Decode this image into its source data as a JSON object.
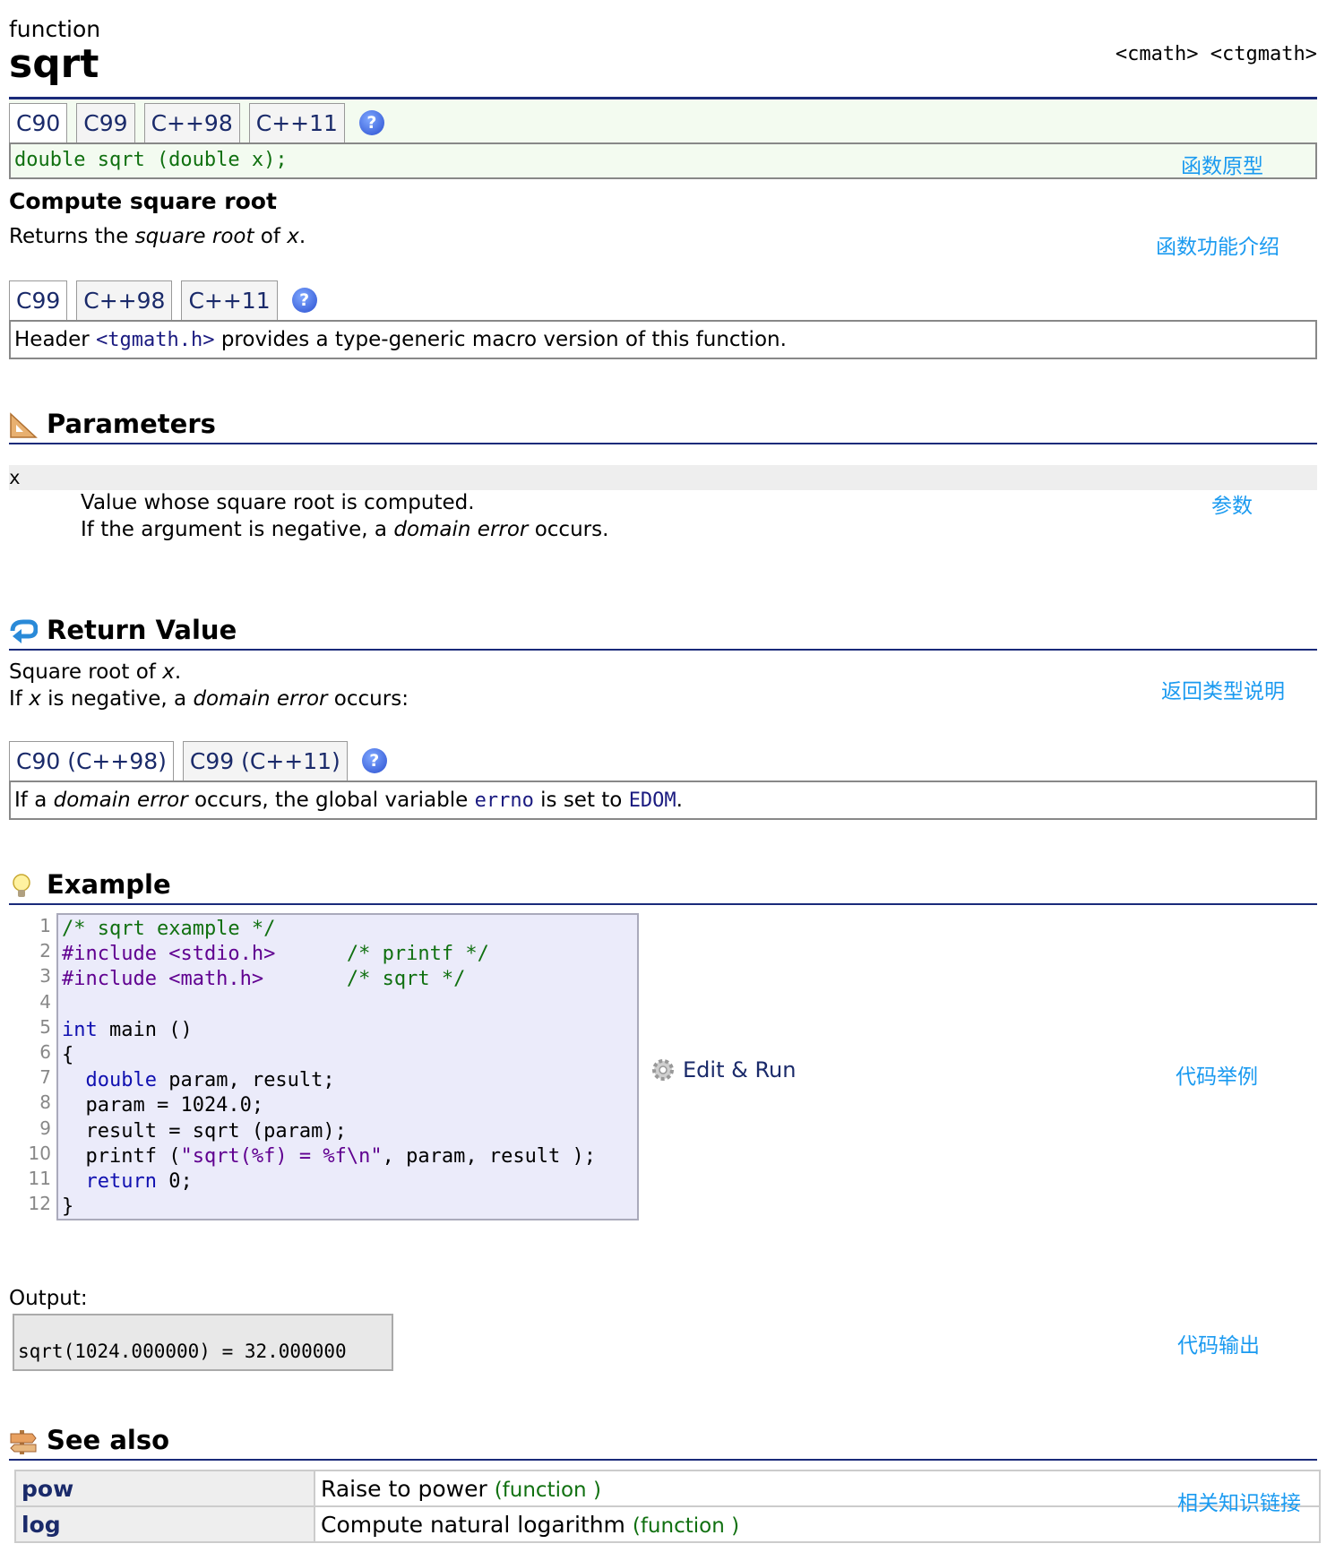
{
  "header": {
    "kind": "function",
    "name": "sqrt",
    "headers": "<cmath> <ctgmath>"
  },
  "prototype": {
    "tabs": [
      "C90",
      "C99",
      "C++98",
      "C++11"
    ],
    "code": "double sqrt (double x);",
    "annotation": "函数原型"
  },
  "description": {
    "title": "Compute square root",
    "text_pre": "Returns the ",
    "text_em": "square root",
    "text_mid": " of ",
    "text_x": "x",
    "text_end": ".",
    "annotation": "函数功能介绍"
  },
  "tgmath": {
    "tabs": [
      "C99",
      "C++98",
      "C++11"
    ],
    "pre": "Header ",
    "code": "<tgmath.h>",
    "post": " provides a type-generic macro version of this function."
  },
  "parameters": {
    "title": "Parameters",
    "name": "x",
    "line1": "Value whose square root is computed.",
    "line2_pre": "If the argument is negative, a ",
    "line2_em": "domain error",
    "line2_post": " occurs.",
    "annotation": "参数"
  },
  "return_value": {
    "title": "Return Value",
    "line1_pre": "Square root of ",
    "line1_x": "x",
    "line1_end": ".",
    "line2_a": "If ",
    "line2_x": "x",
    "line2_b": " is negative, a ",
    "line2_em": "domain error",
    "line2_c": " occurs:",
    "annotation": "返回类型说明",
    "tabs": [
      "C90 (C++98)",
      "C99 (C++11)"
    ],
    "box_a": "If a ",
    "box_em": "domain error",
    "box_b": " occurs, the global variable ",
    "box_code1": "errno",
    "box_c": " is set to ",
    "box_code2": "EDOM",
    "box_d": "."
  },
  "example": {
    "title": "Example",
    "line_numbers": [
      "1",
      "2",
      "3",
      "4",
      "5",
      "6",
      "7",
      "8",
      "9",
      "10",
      "11",
      "12"
    ],
    "edit_run": "Edit & Run",
    "annotation": "代码举例",
    "output_label": "Output:",
    "output": "sqrt(1024.000000) = 32.000000",
    "output_annotation": "代码输出"
  },
  "see_also": {
    "title": "See also",
    "annotation": "相关知识链接",
    "rows": [
      {
        "name": "pow",
        "desc": "Raise to power ",
        "tag": "(function )"
      },
      {
        "name": "log",
        "desc": "Compute natural logarithm ",
        "tag": "(function )"
      }
    ]
  },
  "help_symbol": "?"
}
